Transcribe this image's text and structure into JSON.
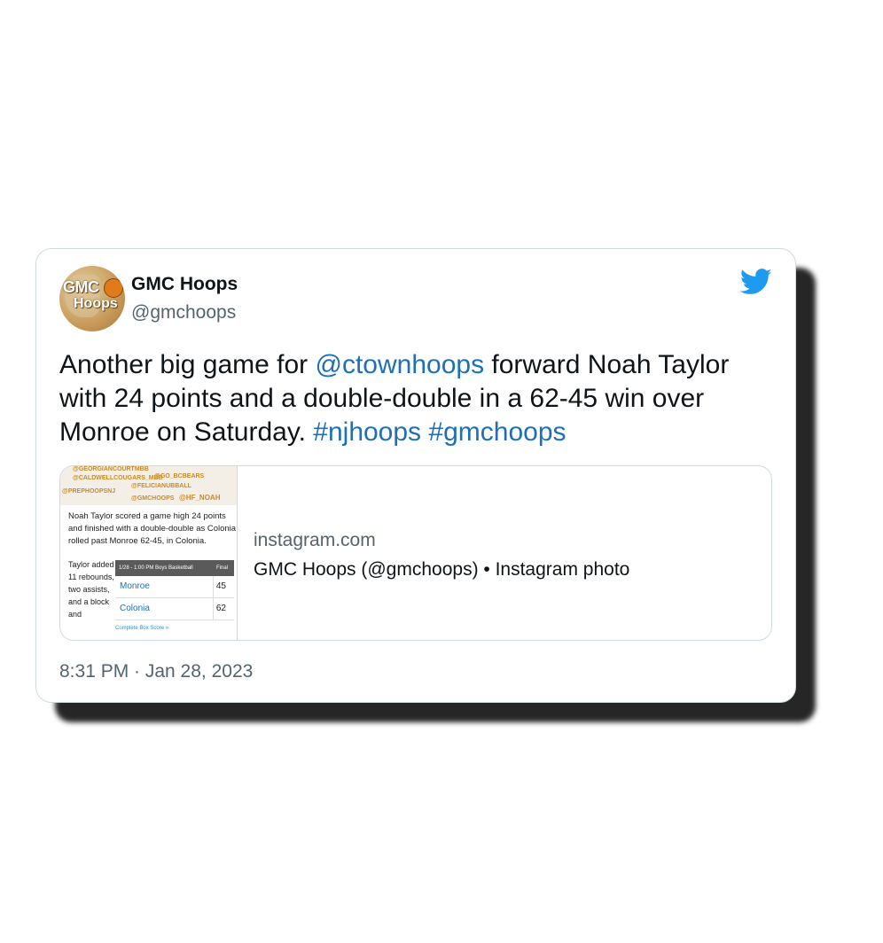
{
  "author": {
    "name": "GMC Hoops",
    "handle": "@gmchoops",
    "avatar_text_1": "GMC",
    "avatar_text_2": "Hoops"
  },
  "tweet": {
    "text_part1": "Another big game for ",
    "mention": "@ctownhoops",
    "text_part2": " forward Noah Taylor with 24 points and a double-double in a 62-45 win over Monroe on Saturday.  ",
    "hashtag1": "#njhoops",
    "space": " ",
    "hashtag2": "#gmchoops"
  },
  "embed": {
    "domain": "instagram.com",
    "title": "GMC Hoops (@gmchoops) • Instagram photo",
    "thumbnail": {
      "tags": [
        "@GEORGIANCOURTMBB",
        "@CALDWELLCOUGARS_MBB",
        "@GO_BCBEARS",
        "@FELICIANUBBALL",
        "@PREPHOOPSNJ",
        "@GMCHOOPS",
        "@HF_NOAH"
      ],
      "paragraph": "Noah Taylor scored a game high 24 points and finished with a double-double as Colonia rolled past Monroe 62-45, in Colonia.",
      "side_text": "Taylor added 11 rebounds, two assists, and a block and",
      "score_header": "1/28 - 1:00 PM Boys Basketball",
      "score_status": "Final",
      "rows": [
        {
          "team": "Monroe",
          "points": "45"
        },
        {
          "team": "Colonia",
          "points": "62"
        }
      ],
      "box_score_link": "Complete Box Score »"
    }
  },
  "timestamp": "8:31 PM · Jan 28, 2023",
  "colors": {
    "link": "#1d6fb8",
    "twitter_blue": "#1d9bf0",
    "secondary_text": "#536471"
  },
  "icons": [
    "twitter-bird-icon"
  ]
}
